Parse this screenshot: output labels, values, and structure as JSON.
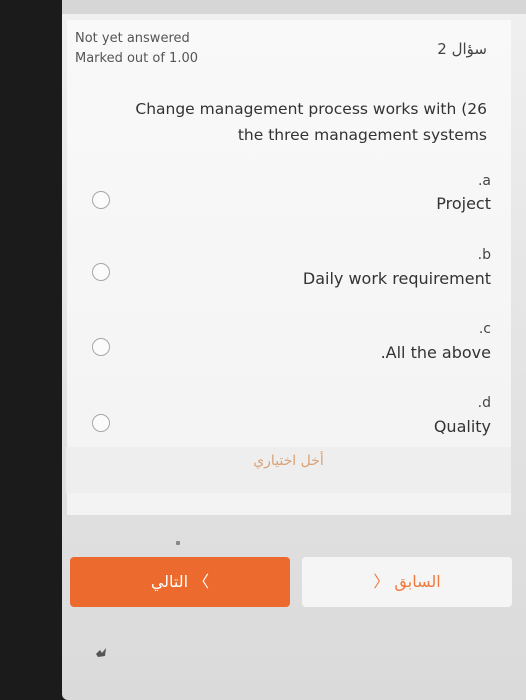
{
  "question": {
    "status": "Not yet answered",
    "marks": "Marked out of 1.00",
    "number_label": "سؤال 2",
    "text_line1": "Change management process works with (26",
    "text_line2": "the three management systems"
  },
  "options": [
    {
      "letter": ".a",
      "label": "Project"
    },
    {
      "letter": ".b",
      "label": "Daily work requirement"
    },
    {
      "letter": ".c",
      "label": ".All the above"
    },
    {
      "letter": ".d",
      "label": "Quality"
    }
  ],
  "clear_choice_label": "أخل اختياري",
  "nav": {
    "next_label": "التالي  〈",
    "prev_label": "〉 السابق"
  },
  "colors": {
    "accent": "#ec6a2e",
    "card_bg": "#f7f7f7",
    "page_bg": "#e6e6e6"
  }
}
